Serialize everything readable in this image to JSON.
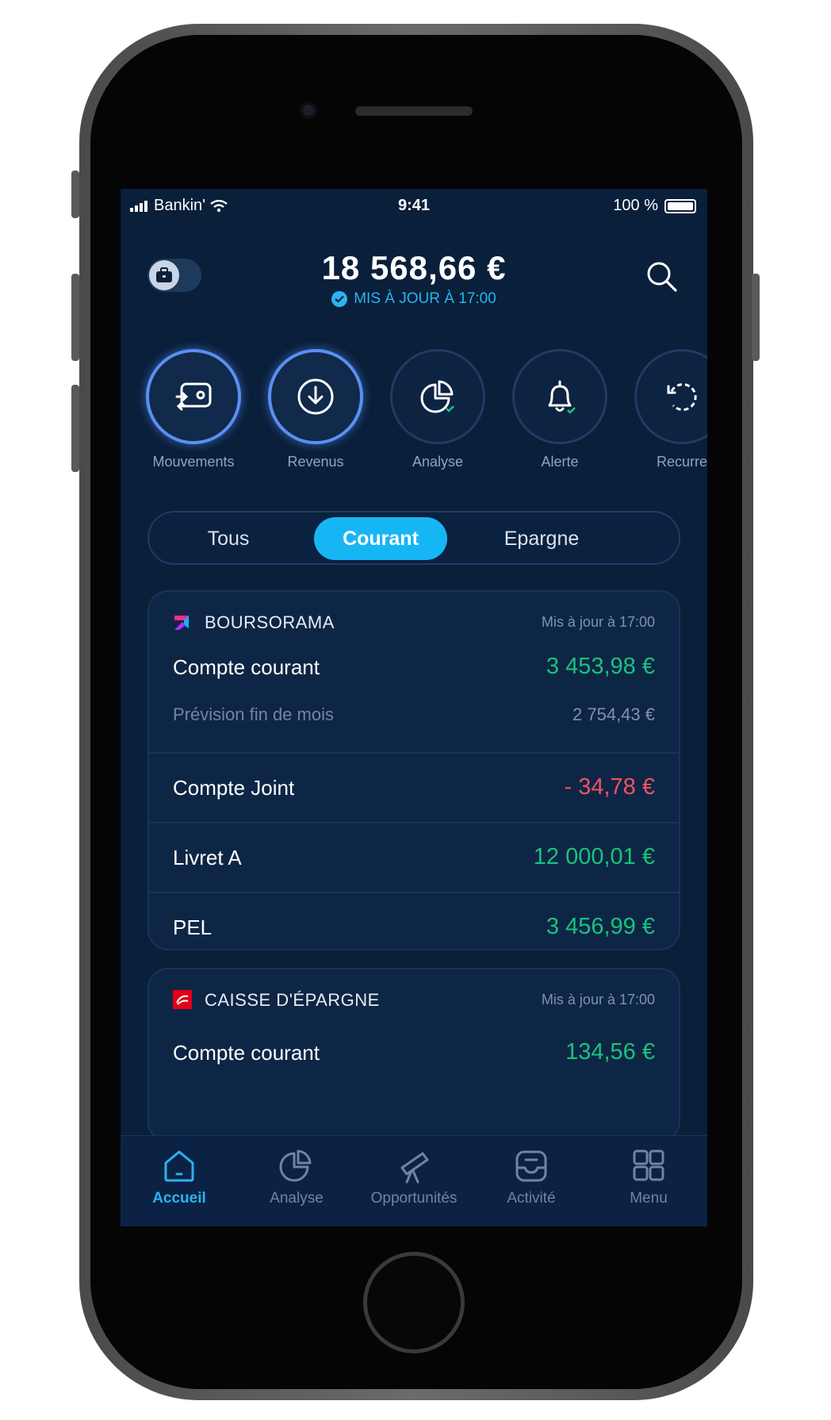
{
  "status_bar": {
    "carrier": "Bankin'",
    "time": "9:41",
    "battery": "100 %"
  },
  "header": {
    "total": "18 568,66 €",
    "updated": "MIS À JOUR À 17:00"
  },
  "shortcuts": [
    {
      "label": "Mouvements",
      "icon": "transfer-card-icon"
    },
    {
      "label": "Revenus",
      "icon": "download-circle-icon"
    },
    {
      "label": "Analyse",
      "icon": "pie-chart-check-icon"
    },
    {
      "label": "Alerte",
      "icon": "bell-check-icon"
    },
    {
      "label": "Recurre",
      "icon": "recurring-icon"
    }
  ],
  "filter_tabs": {
    "all": "Tous",
    "current": "Courant",
    "savings": "Epargne",
    "selected": "Courant"
  },
  "banks": [
    {
      "name": "BOURSORAMA",
      "updated": "Mis à jour à 17:00",
      "accounts": [
        {
          "name": "Compte courant",
          "amount": "3 453,98 €",
          "status": "positive"
        },
        {
          "name": "Compte Joint",
          "amount": "- 34,78 €",
          "status": "negative"
        },
        {
          "name": "Livret A",
          "amount": "12 000,01 €",
          "status": "positive"
        },
        {
          "name": "PEL",
          "amount": "3 456,99 €",
          "status": "positive"
        }
      ],
      "forecast": {
        "label": "Prévision fin de mois",
        "amount": "2 754,43 €"
      }
    },
    {
      "name": "CAISSE D'ÉPARGNE",
      "updated": "Mis à jour à 17:00",
      "accounts": [
        {
          "name": "Compte courant",
          "amount": "134,56 €",
          "status": "positive"
        }
      ]
    }
  ],
  "bottom_nav": [
    {
      "label": "Accueil",
      "icon": "home-icon",
      "active": true
    },
    {
      "label": "Analyse",
      "icon": "pie-chart-icon",
      "active": false
    },
    {
      "label": "Opportunités",
      "icon": "telescope-icon",
      "active": false
    },
    {
      "label": "Activité",
      "icon": "inbox-icon",
      "active": false
    },
    {
      "label": "Menu",
      "icon": "grid-icon",
      "active": false
    }
  ],
  "colors": {
    "background": "#0a1f3a",
    "accent": "#16b6f5",
    "positive": "#19c27d",
    "negative": "#f05265"
  }
}
